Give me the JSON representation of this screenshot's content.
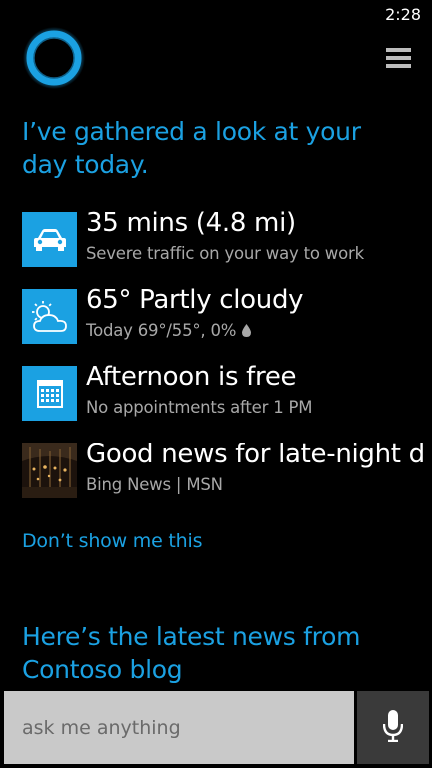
{
  "status_bar": {
    "time": "2:28"
  },
  "header": {
    "logo_icon": "cortana-ring-icon",
    "menu_icon": "hamburger-menu-icon"
  },
  "greeting": "I’ve gathered a look at your day today.",
  "cards": [
    {
      "icon": "car-icon",
      "title": "35 mins (4.8 mi)",
      "subtitle": "Severe traffic on your way to work"
    },
    {
      "icon": "weather-partly-cloudy-icon",
      "title": "65° Partly cloudy",
      "subtitle": "Today 69°/55°, 0%",
      "extra_icon": "raindrop-icon"
    },
    {
      "icon": "calendar-icon",
      "title": "Afternoon is free",
      "subtitle": "No appointments after 1 PM"
    },
    {
      "icon": "news-thumbnail-image",
      "title": "Good news for late-night d",
      "subtitle": "Bing News | MSN"
    }
  ],
  "dont_show_label": "Don’t show me this",
  "news_heading": "Here’s the latest news from Contoso blog",
  "search": {
    "placeholder": "ask me anything",
    "value": ""
  },
  "mic_icon": "microphone-icon",
  "colors": {
    "accent": "#1ba1e2",
    "background": "#000000",
    "subtext": "#a8a8a8",
    "input_bg": "#c9c9c9",
    "mic_bg": "#3a3a3a"
  }
}
